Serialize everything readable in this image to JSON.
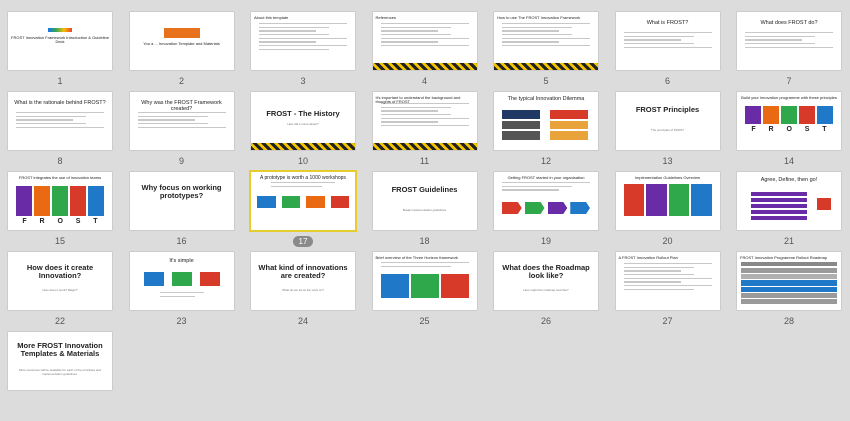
{
  "slides": [
    {
      "number": "1",
      "title": "FROST Innovation Framework Introduction & Guideline Deck",
      "style": "cover",
      "palette": [
        "#1a73e8",
        "#34a853",
        "#fbbc05",
        "#ea4335"
      ]
    },
    {
      "number": "2",
      "title": "You a ... Innovation Template and Materials",
      "style": "orange"
    },
    {
      "number": "3",
      "title": "About this template",
      "style": "text"
    },
    {
      "number": "4",
      "title": "References",
      "style": "text-stripe"
    },
    {
      "number": "5",
      "title": "How to use The FROST Innovation Framework",
      "style": "text-stripe"
    },
    {
      "number": "6",
      "title": "What is FROST?",
      "style": "heading-list"
    },
    {
      "number": "7",
      "title": "What does FROST do?",
      "style": "heading-list"
    },
    {
      "number": "8",
      "title": "What is the rationale behind FROST?",
      "style": "heading-list"
    },
    {
      "number": "9",
      "title": "Why was the FROST Framework created?",
      "style": "heading-list"
    },
    {
      "number": "10",
      "title": "FROST - The History",
      "subtitle": "How did it come about?",
      "style": "section-stripe"
    },
    {
      "number": "11",
      "title": "It's important to understand the background and thoughts of FROST",
      "style": "text-stripe"
    },
    {
      "number": "12",
      "title": "The typical Innovation Dilemma",
      "style": "dilemma"
    },
    {
      "number": "13",
      "title": "FROST Principles",
      "subtitle": "The principles of FROST",
      "style": "section"
    },
    {
      "number": "14",
      "title": "Build your innovation programme with these principles",
      "letters": [
        "F",
        "R",
        "O",
        "S",
        "T"
      ],
      "style": "frost"
    },
    {
      "number": "15",
      "title": "FROST integrates the use of innovation teams",
      "letters": [
        "F",
        "R",
        "O",
        "S",
        "T"
      ],
      "style": "frost-grid"
    },
    {
      "number": "16",
      "title": "Why focus on working prototypes?",
      "style": "section"
    },
    {
      "number": "17",
      "title": "A prototype is worth a 1000 workshops",
      "style": "process",
      "selected": true
    },
    {
      "number": "18",
      "title": "FROST Guidelines",
      "subtitle": "Break implementation guidelines",
      "style": "section"
    },
    {
      "number": "19",
      "title": "Getting FROST started in your organisation",
      "style": "guideline-arrows"
    },
    {
      "number": "20",
      "title": "Implementation Guidelines Overview",
      "style": "columns"
    },
    {
      "number": "21",
      "title": "Agree, Define, then go!",
      "style": "purple-arrows"
    },
    {
      "number": "22",
      "title": "How does it create Innovation?",
      "subtitle": "How does it work? Magic?",
      "style": "section"
    },
    {
      "number": "23",
      "title": "It's simple",
      "style": "simple"
    },
    {
      "number": "24",
      "title": "What kind of innovations are created?",
      "subtitle": "What do we focus the work on?",
      "style": "section"
    },
    {
      "number": "25",
      "title": "Brief overview of the Three Horizon framework",
      "style": "horizons"
    },
    {
      "number": "26",
      "title": "What does the Roadmap look like?",
      "subtitle": "How might the roadmap look like?",
      "style": "section"
    },
    {
      "number": "27",
      "title": "A FROST Innovation Rollout Plan",
      "style": "text"
    },
    {
      "number": "28",
      "title": "FROST Innovation Programme Rollout Roadmap",
      "style": "roadmap"
    },
    {
      "number": "",
      "title": "More FROST Innovation Templates & Materials",
      "subtitle": "More resources will be available for each of the principles and implementation guidelines.",
      "style": "section-last"
    }
  ]
}
